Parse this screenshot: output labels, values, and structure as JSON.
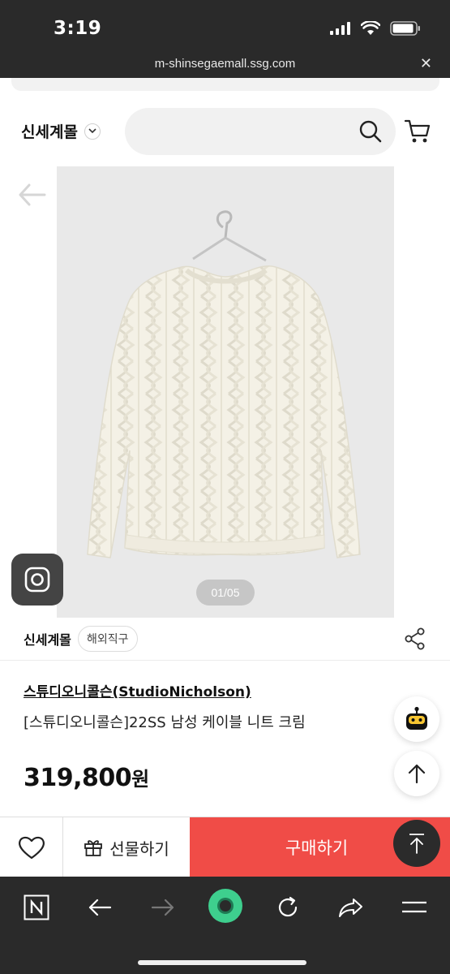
{
  "status_bar": {
    "time": "3:19"
  },
  "url_bar": {
    "url": "m-shinsegaemall.ssg.com"
  },
  "header": {
    "brand_label": "신세계몰"
  },
  "search": {
    "placeholder": ""
  },
  "gallery": {
    "page_indicator": "01/05"
  },
  "seller": {
    "name": "신세계몰",
    "badge": "해외직구"
  },
  "product": {
    "brand": "스튜디오니콜슨(StudioNicholson)",
    "title": "[스튜디오니콜슨]22SS 남성 케이블 니트 크림",
    "price": "319,800",
    "price_unit": "원"
  },
  "purchase_bar": {
    "gift_label": "선물하기",
    "buy_label": "구매하기"
  },
  "colors": {
    "buy_button": "#f04c47",
    "toolbar_bg": "#2a2a2a",
    "toolbar_center": "#3ecf8e"
  },
  "icons": [
    "back-arrow-icon",
    "search-icon",
    "cart-icon",
    "instagram-icon",
    "share-icon",
    "chatbot-icon",
    "arrow-up-icon",
    "heart-icon",
    "gift-icon",
    "n-tab-icon",
    "reload-icon",
    "share-arrow-icon",
    "menu-icon"
  ]
}
